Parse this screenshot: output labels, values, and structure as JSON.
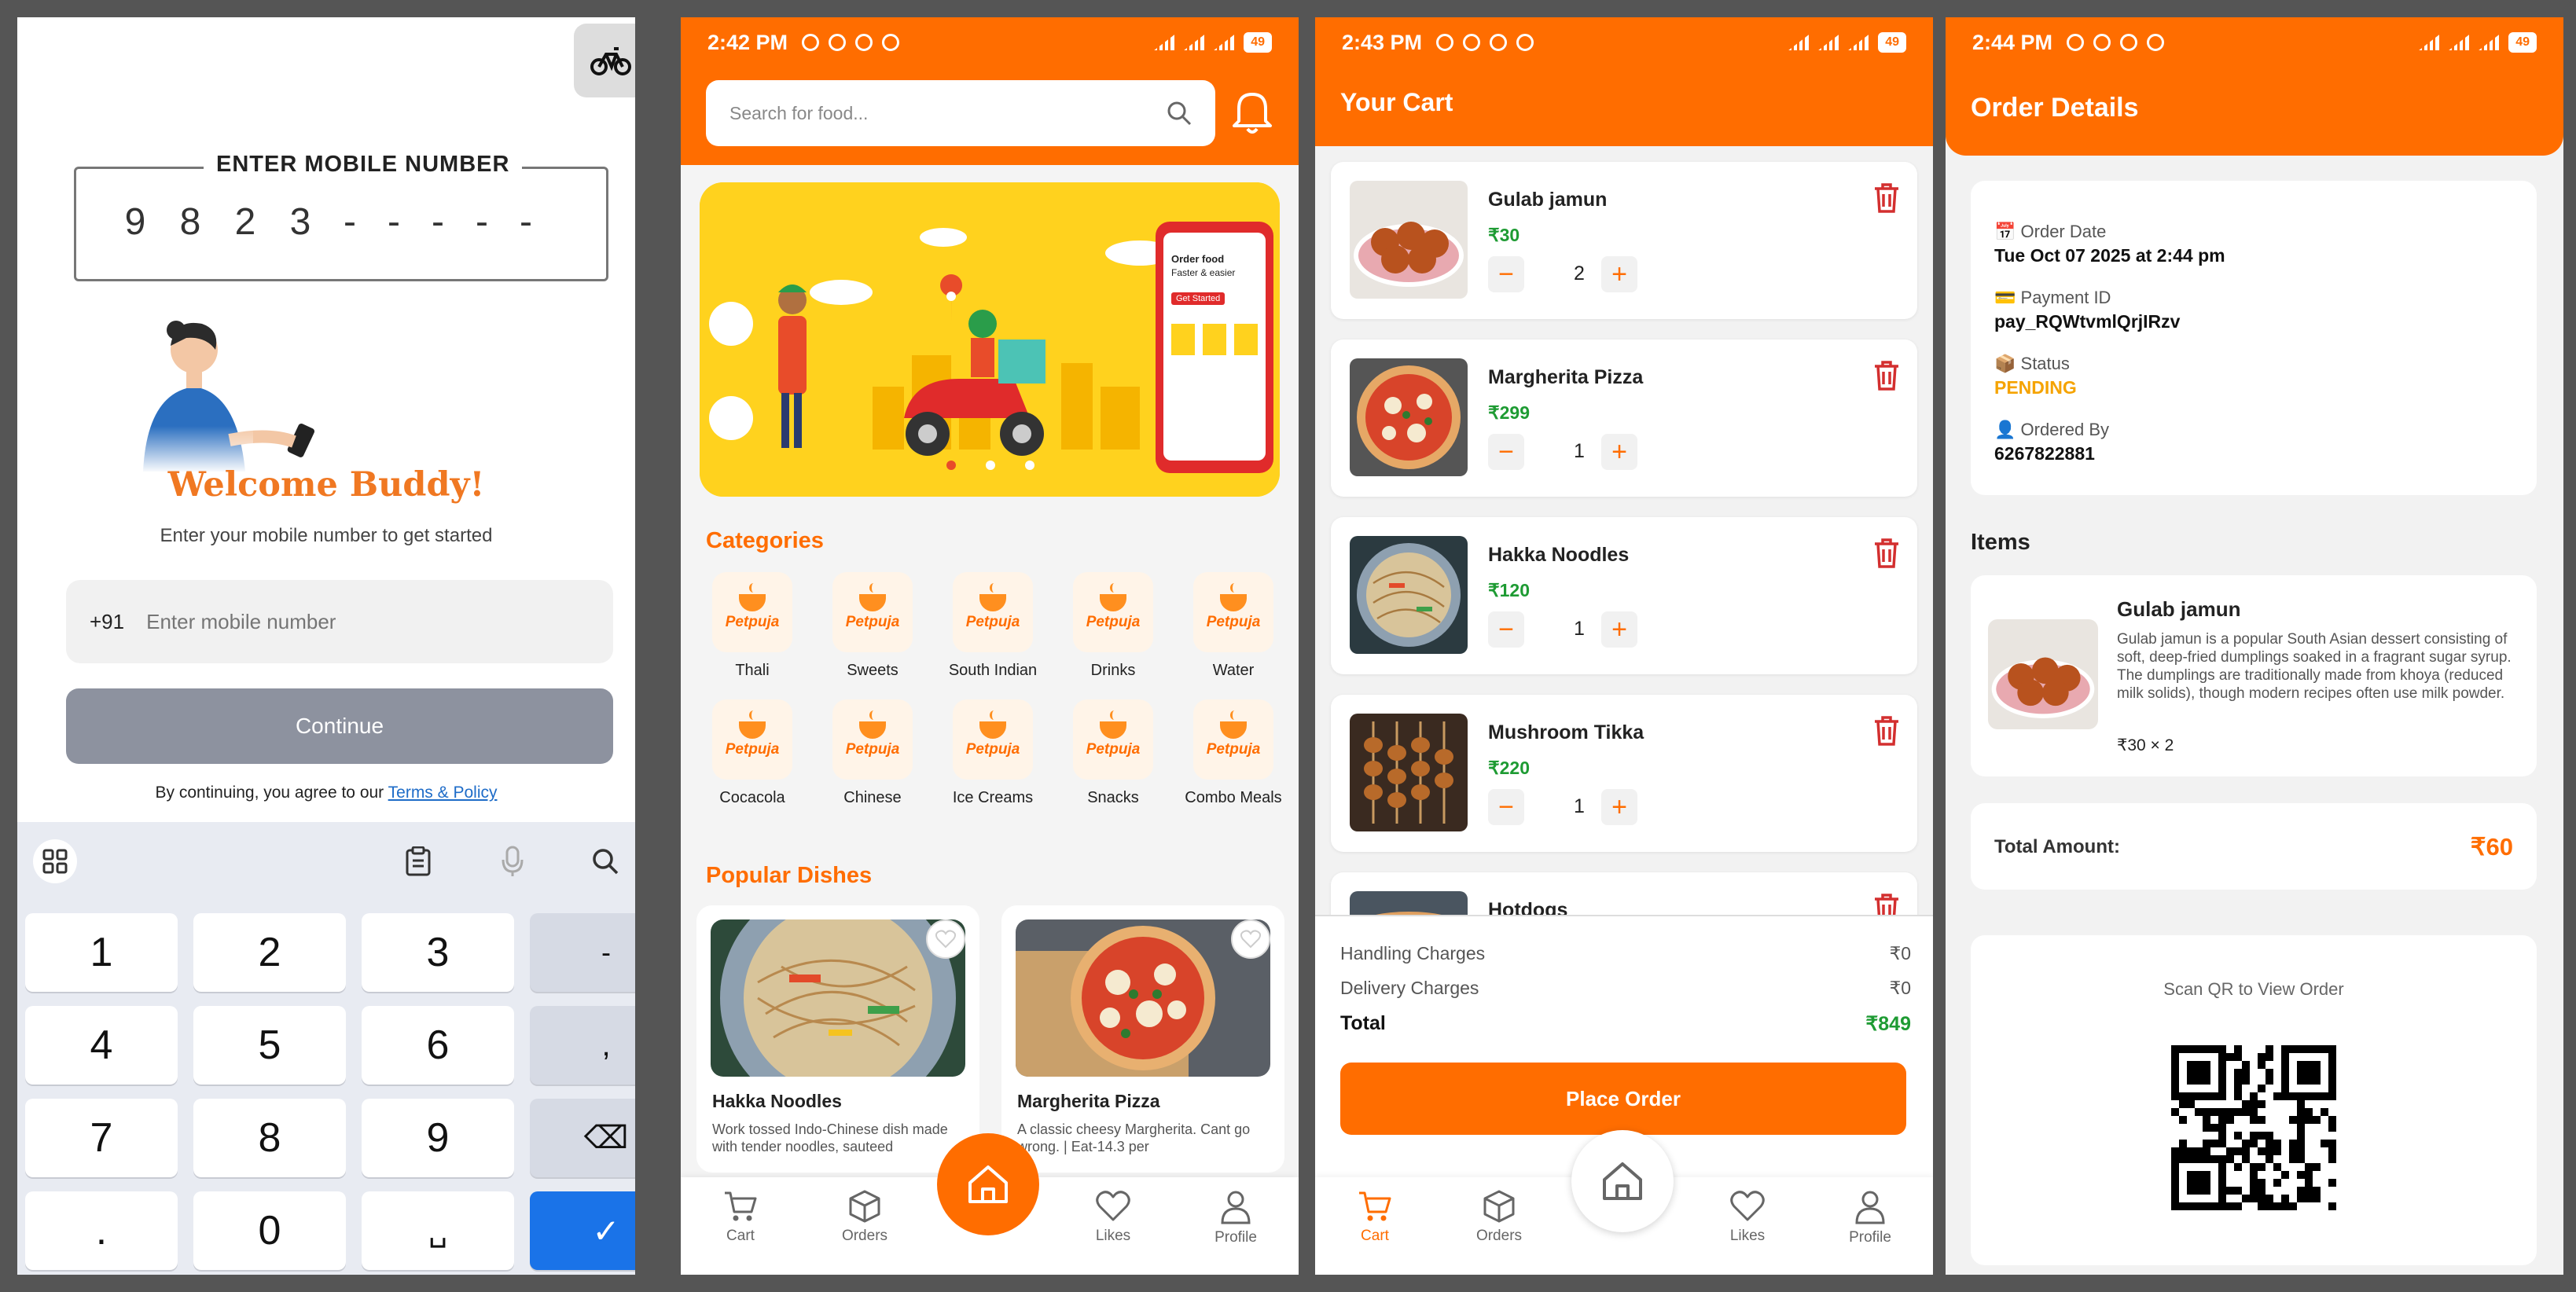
{
  "login": {
    "otp_label": "ENTER MOBILE NUMBER",
    "otp_digits": [
      "9",
      "8",
      "2",
      "3",
      "-",
      "-",
      "-",
      "-",
      "-"
    ],
    "welcome": "Welcome Buddy!",
    "subtitle": "Enter your mobile number to get started",
    "country_code": "+91",
    "mobile_placeholder": "Enter mobile number",
    "continue": "Continue",
    "terms_prefix": "By continuing, you agree to our ",
    "terms_link": "Terms & Policy"
  },
  "keyboard": {
    "keys": [
      "1",
      "2",
      "3",
      "-",
      "4",
      "5",
      "6",
      ",",
      "7",
      "8",
      "9",
      "⌫",
      ".",
      "0",
      "␣",
      "✓"
    ]
  },
  "home": {
    "status_time": "2:42 PM",
    "battery": "49",
    "search_placeholder": "Search for food...",
    "categories_title": "Categories",
    "categories": [
      "Thali",
      "Sweets",
      "South Indian",
      "Drinks",
      "Water",
      "Cocacola",
      "Chinese",
      "Ice Creams",
      "Snacks",
      "Combo Meals"
    ],
    "brand": "Petpuja",
    "popular_title": "Popular Dishes",
    "dishes": [
      {
        "name": "Hakka Noodles",
        "desc": "Work tossed Indo-Chinese dish made with tender noodles, sauteed"
      },
      {
        "name": "Margherita Pizza",
        "desc": "A classic cheesy Margherita. Cant go wrong. | Eat-14.3 per"
      }
    ],
    "banner_text_1": "Order food",
    "banner_text_2": "Faster & easier",
    "banner_btn": "Get Started"
  },
  "nav": {
    "cart": "Cart",
    "orders": "Orders",
    "likes": "Likes",
    "profile": "Profile"
  },
  "cart": {
    "status_time": "2:43 PM",
    "title": "Your Cart",
    "items": [
      {
        "name": "Gulab jamun",
        "price": "₹30",
        "qty": "2"
      },
      {
        "name": "Margherita Pizza",
        "price": "₹299",
        "qty": "1"
      },
      {
        "name": "Hakka Noodles",
        "price": "₹120",
        "qty": "1"
      },
      {
        "name": "Mushroom Tikka",
        "price": "₹220",
        "qty": "1"
      },
      {
        "name": "Hotdogs",
        "price": "",
        "qty": ""
      }
    ],
    "handling_label": "Handling Charges",
    "handling_value": "₹0",
    "delivery_label": "Delivery Charges",
    "delivery_value": "₹0",
    "total_label": "Total",
    "total_value": "₹849",
    "place_order": "Place Order"
  },
  "order": {
    "status_time": "2:44 PM",
    "title": "Order Details",
    "order_date_label": "Order Date",
    "order_date": "Tue Oct 07 2025 at 2:44 pm",
    "payment_label": "Payment ID",
    "payment_id": "pay_RQWtvmlQrjIRzv",
    "status_label": "Status",
    "status": "PENDING",
    "ordered_by_label": "Ordered By",
    "ordered_by": "6267822881",
    "items_title": "Items",
    "item_name": "Gulab jamun",
    "item_desc": "Gulab jamun is a popular South Asian dessert consisting of soft, deep-fried dumplings soaked in a fragrant sugar syrup. The dumplings are traditionally made from khoya (reduced milk solids), though modern recipes often use milk powder.",
    "item_qty": "₹30 × 2",
    "total_label": "Total Amount:",
    "total_value": "₹60",
    "qr_label": "Scan QR to View Order"
  },
  "colors": {
    "accent": "#ff6d00",
    "price_green": "#1e9b33",
    "continue_gray": "#8d929f",
    "key_blue": "#1a73e8"
  }
}
